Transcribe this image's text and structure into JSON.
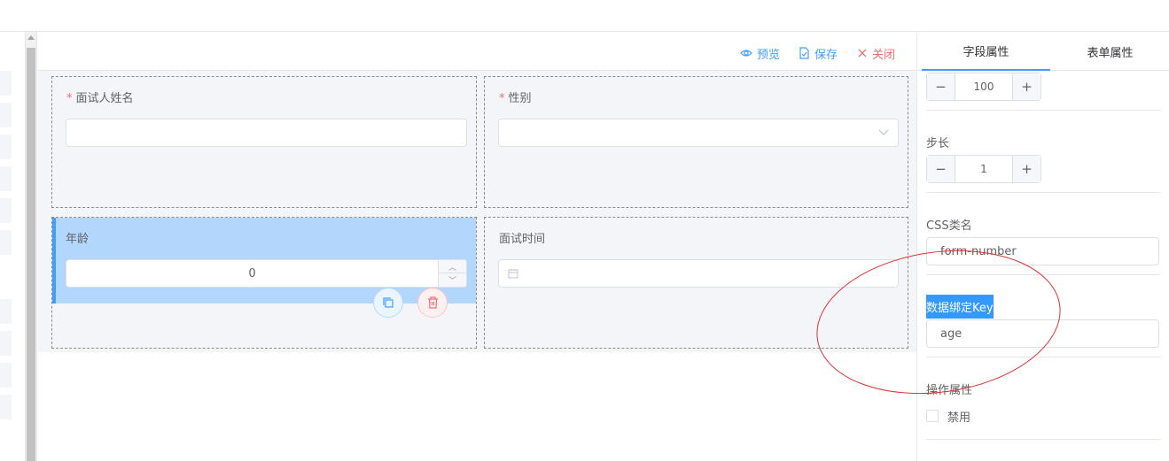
{
  "toolbar": {
    "preview_label": "预览",
    "save_label": "保存",
    "close_label": "关闭"
  },
  "form": {
    "fields": [
      {
        "label": "面试人姓名",
        "required": true,
        "type": "input"
      },
      {
        "label": "性别",
        "required": true,
        "type": "select"
      },
      {
        "label": "年龄",
        "required": false,
        "type": "number",
        "value": "0"
      },
      {
        "label": "面试时间",
        "required": false,
        "type": "date"
      }
    ],
    "required_mark": "*"
  },
  "right_panel": {
    "tabs": [
      {
        "label": "字段属性",
        "active": true
      },
      {
        "label": "表单属性",
        "active": false
      }
    ],
    "max_value": "100",
    "step": {
      "label": "步长",
      "value": "1"
    },
    "css_class": {
      "label": "CSS类名",
      "value": "form-number"
    },
    "data_key": {
      "label": "数据绑定Key",
      "value": "age"
    },
    "operation": {
      "label": "操作属性",
      "disabled_label": "禁用"
    }
  },
  "colors": {
    "accent": "#409eff",
    "danger": "#f56c6c",
    "selected_bg": "#b3d6fd",
    "annotation": "#e03030"
  }
}
